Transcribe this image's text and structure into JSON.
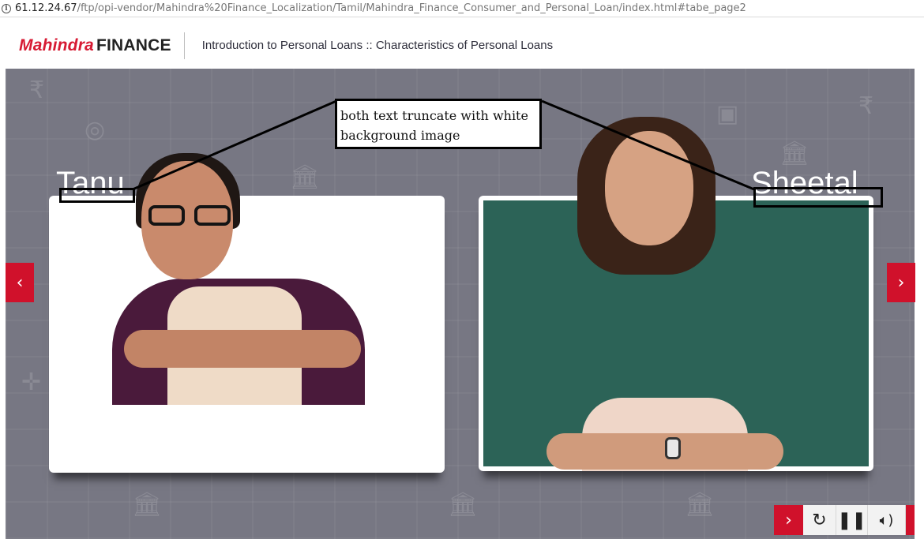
{
  "browser": {
    "url_host": "61.12.24.67",
    "url_path": "/ftp/opi-vendor/Mahindra%20Finance_Localization/Tamil/Mahindra_Finance_Consumer_and_Personal_Loan/index.html#tabe_page2"
  },
  "header": {
    "logo_brand": "Mahindra",
    "logo_finance": "FINANCE",
    "title": "Introduction to Personal Loans :: Characteristics of Personal Loans"
  },
  "characters": [
    {
      "name": "Tanu"
    },
    {
      "name": "Sheetal"
    }
  ],
  "annotation": {
    "text_line1": "both text truncate with white",
    "text_line2": "background image"
  },
  "navigation": {
    "prev_icon": "chevron-left-icon",
    "next_icon": "chevron-right-icon"
  },
  "controls": {
    "next_icon": "chevron-right-icon",
    "replay_icon": "replay-icon",
    "pause_icon": "pause-icon",
    "audio_icon": "speaker-icon"
  },
  "colors": {
    "brand_red": "#d0112b",
    "stage_gray": "#777783",
    "sheetal_backdrop": "#2c6357"
  }
}
